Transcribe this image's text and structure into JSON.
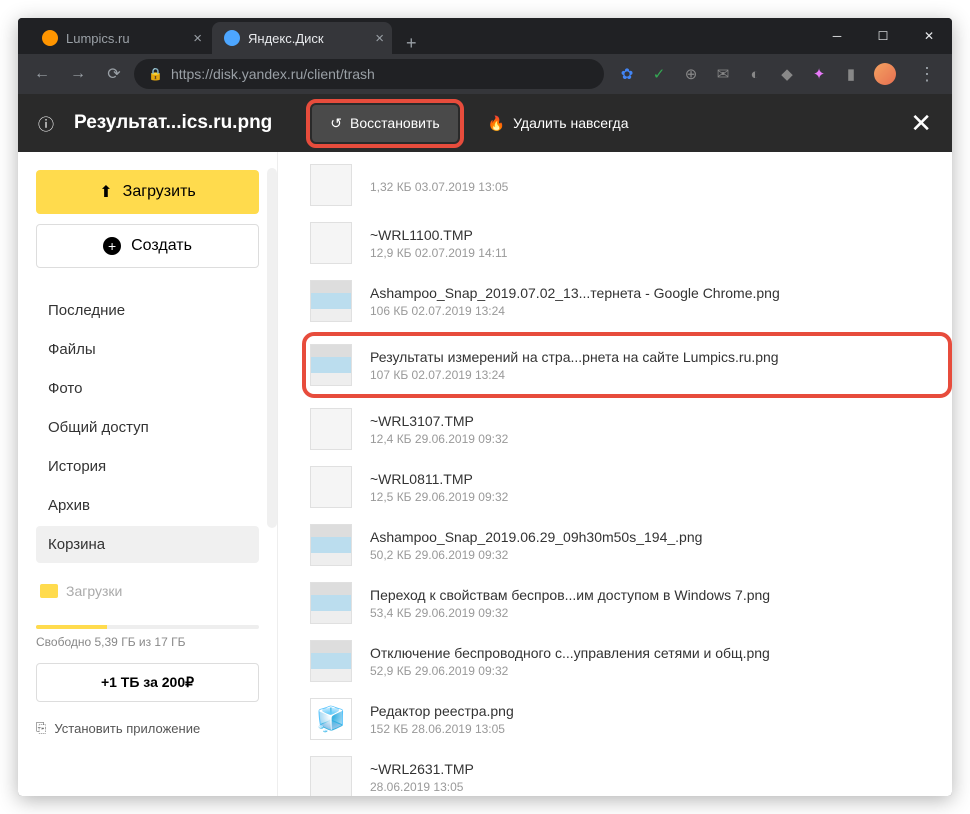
{
  "browser": {
    "tabs": [
      {
        "title": "Lumpics.ru",
        "icon_color": "#ff9500",
        "active": false
      },
      {
        "title": "Яндекс.Диск",
        "icon_color": "#4da6ff",
        "active": true
      }
    ],
    "url": "https://disk.yandex.ru/client/trash"
  },
  "actionbar": {
    "filename": "Результат...ics.ru.png",
    "restore": "Восстановить",
    "delete": "Удалить навсегда"
  },
  "sidebar": {
    "upload": "Загрузить",
    "create": "Создать",
    "nav": [
      {
        "label": "Последние"
      },
      {
        "label": "Файлы"
      },
      {
        "label": "Фото"
      },
      {
        "label": "Общий доступ"
      },
      {
        "label": "История"
      },
      {
        "label": "Архив"
      },
      {
        "label": "Корзина",
        "active": true
      }
    ],
    "folder": "Загрузки",
    "storage": "Свободно 5,39 ГБ из 17 ГБ",
    "promo": "+1 ТБ за 200₽",
    "install": "Установить приложение"
  },
  "files": [
    {
      "name": "",
      "meta": "1,32 КБ   03.07.2019   13:05",
      "thumb": "blank"
    },
    {
      "name": "~WRL1100.TMP",
      "meta": "12,9 КБ   02.07.2019   14:11",
      "thumb": "blank"
    },
    {
      "name": "Ashampoo_Snap_2019.07.02_13...тернета - Google Chrome.png",
      "meta": "106 КБ   02.07.2019   13:24",
      "thumb": "img"
    },
    {
      "name": "Результаты измерений на стра...рнета на сайте Lumpics.ru.png",
      "meta": "107 КБ   02.07.2019   13:24",
      "thumb": "img",
      "selected": true
    },
    {
      "name": "~WRL3107.TMP",
      "meta": "12,4 КБ   29.06.2019   09:32",
      "thumb": "blank"
    },
    {
      "name": "~WRL0811.TMP",
      "meta": "12,5 КБ   29.06.2019   09:32",
      "thumb": "blank"
    },
    {
      "name": "Ashampoo_Snap_2019.06.29_09h30m50s_194_.png",
      "meta": "50,2 КБ   29.06.2019   09:32",
      "thumb": "img"
    },
    {
      "name": "Переход к свойствам беспров...им доступом в Windows 7.png",
      "meta": "53,4 КБ   29.06.2019   09:32",
      "thumb": "img"
    },
    {
      "name": "Отключение беспроводного с...управления сетями и общ.png",
      "meta": "52,9 КБ   29.06.2019   09:32",
      "thumb": "img"
    },
    {
      "name": "Редактор реестра.png",
      "meta": "152 КБ   28.06.2019   13:05",
      "thumb": "cube"
    },
    {
      "name": "~WRL2631.TMP",
      "meta": "28.06.2019   13:05",
      "thumb": "blank"
    }
  ]
}
